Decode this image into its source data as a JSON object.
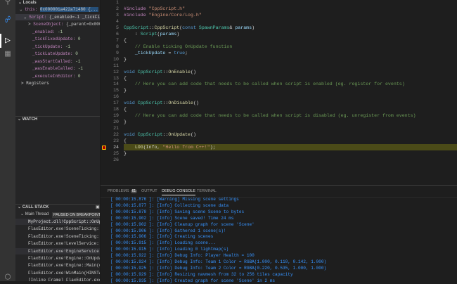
{
  "activity_bar": {
    "icons": [
      "search-icon",
      "source-control-icon",
      "run-debug-icon",
      "extensions-icon",
      "account-icon"
    ]
  },
  "variables": {
    "section": "Locals",
    "rows": [
      {
        "indent": 1,
        "chev": "v",
        "name": "this:",
        "value": "0x000001a422a71480 {...",
        "kind": "sel"
      },
      {
        "indent": 2,
        "chev": "v",
        "name": "Script:",
        "value": "{_enabled=-1 _tickFi...",
        "kind": "obj"
      },
      {
        "indent": 3,
        "chev": ">",
        "name": "SceneObject:",
        "value": "{_parent=0x000...",
        "kind": "obj"
      },
      {
        "indent": 4,
        "chev": "",
        "name": "_enabled:",
        "value": "-1",
        "kind": "num"
      },
      {
        "indent": 4,
        "chev": "",
        "name": "_tickFixedUpdate:",
        "value": "0",
        "kind": "num"
      },
      {
        "indent": 4,
        "chev": "",
        "name": "_tickUpdate:",
        "value": "-1",
        "kind": "num"
      },
      {
        "indent": 4,
        "chev": "",
        "name": "_tickLateUpdate:",
        "value": "0",
        "kind": "num"
      },
      {
        "indent": 4,
        "chev": "",
        "name": "_wasStartCalled:",
        "value": "-1",
        "kind": "num"
      },
      {
        "indent": 4,
        "chev": "",
        "name": "_wasEnableCalled:",
        "value": "-1",
        "kind": "num"
      },
      {
        "indent": 4,
        "chev": "",
        "name": "_executeInEditor:",
        "value": "0",
        "kind": "num"
      }
    ],
    "registers": "Registers"
  },
  "watch": {
    "title": "WATCH"
  },
  "call_stack": {
    "title": "CALL STACK",
    "thread": "Main Thread",
    "status": "PAUSED ON BREAKPOINT",
    "frames": [
      "MyProject.dll!CppScript::OnUpdate()",
      "FlaxEditor.exe!SceneTicking::Update",
      "FlaxEditor.exe!SceneTicking::Tick",
      "FlaxEditor.exe!LevelService::Update",
      "FlaxEditor.exe!EngineService::OnUpdate",
      "FlaxEditor.exe!Engine::OnUpdate()",
      "FlaxEditor.exe!Engine::Main(const",
      "FlaxEditor.exe!WinMain(HINSTANCE",
      "[Inline Frame] FlaxEditor.exe!..."
    ]
  },
  "editor": {
    "current_line": 24,
    "lines": [
      {
        "n": "1",
        "t": []
      },
      {
        "n": "2",
        "t": [
          [
            "#include ",
            "pp"
          ],
          [
            "\"CppScript.h\"",
            "str"
          ]
        ]
      },
      {
        "n": "3",
        "t": [
          [
            "#include ",
            "pp"
          ],
          [
            "\"Engine/Core/Log.h\"",
            "str"
          ]
        ]
      },
      {
        "n": "4",
        "t": []
      },
      {
        "n": "5",
        "t": [
          [
            "CppScript",
            "ty"
          ],
          [
            "::",
            "pl"
          ],
          [
            "CppScript",
            "fn"
          ],
          [
            "(",
            "pl"
          ],
          [
            "const ",
            "kw"
          ],
          [
            "SpawnParams",
            "ty"
          ],
          [
            "& ",
            "pl"
          ],
          [
            "params",
            "var"
          ],
          [
            ")",
            "pl"
          ]
        ]
      },
      {
        "n": "6",
        "t": [
          [
            "    : ",
            "pl"
          ],
          [
            "Script",
            "ty"
          ],
          [
            "(",
            "pl"
          ],
          [
            "params",
            "var"
          ],
          [
            ")",
            "pl"
          ]
        ]
      },
      {
        "n": "7",
        "t": [
          [
            "{",
            "pl"
          ]
        ]
      },
      {
        "n": "8",
        "t": [
          [
            "    // Enable ticking OnUpdate function",
            "cm"
          ]
        ]
      },
      {
        "n": "9",
        "t": [
          [
            "    ",
            "pl"
          ],
          [
            "_tickUpdate",
            "var"
          ],
          [
            " = ",
            "pl"
          ],
          [
            "true",
            "kw"
          ],
          [
            ";",
            "pl"
          ]
        ]
      },
      {
        "n": "10",
        "t": [
          [
            "}",
            "pl"
          ]
        ]
      },
      {
        "n": "11",
        "t": []
      },
      {
        "n": "12",
        "t": [
          [
            "void ",
            "kw"
          ],
          [
            "CppScript",
            "ty"
          ],
          [
            "::",
            "pl"
          ],
          [
            "OnEnable",
            "fn"
          ],
          [
            "()",
            "pl"
          ]
        ]
      },
      {
        "n": "13",
        "t": [
          [
            "{",
            "pl"
          ]
        ]
      },
      {
        "n": "14",
        "t": [
          [
            "    // Here you can add code that needs to be called when script is enabled (eg. register for events)",
            "cm"
          ]
        ]
      },
      {
        "n": "15",
        "t": [
          [
            "}",
            "pl"
          ]
        ]
      },
      {
        "n": "16",
        "t": []
      },
      {
        "n": "17",
        "t": [
          [
            "void ",
            "kw"
          ],
          [
            "CppScript",
            "ty"
          ],
          [
            "::",
            "pl"
          ],
          [
            "OnDisable",
            "fn"
          ],
          [
            "()",
            "pl"
          ]
        ]
      },
      {
        "n": "18",
        "t": [
          [
            "{",
            "pl"
          ]
        ]
      },
      {
        "n": "19",
        "t": [
          [
            "    // Here you can add code that needs to be called when script is disabled (eg. unregister from events)",
            "cm"
          ]
        ]
      },
      {
        "n": "20",
        "t": [
          [
            "}",
            "pl"
          ]
        ]
      },
      {
        "n": "21",
        "t": []
      },
      {
        "n": "22",
        "t": [
          [
            "void ",
            "kw"
          ],
          [
            "CppScript",
            "ty"
          ],
          [
            "::",
            "pl"
          ],
          [
            "OnUpdate",
            "fn"
          ],
          [
            "()",
            "pl"
          ]
        ]
      },
      {
        "n": "23",
        "t": [
          [
            "{",
            "pl"
          ]
        ]
      },
      {
        "n": "24",
        "t": [
          [
            "    ",
            "pl"
          ],
          [
            "LOG",
            "fn"
          ],
          [
            "(Info, ",
            "pl"
          ],
          [
            "\"Hello from C++!\"",
            "str"
          ],
          [
            ");",
            "pl"
          ]
        ]
      },
      {
        "n": "25",
        "t": [
          [
            "}",
            "pl"
          ]
        ]
      },
      {
        "n": "26",
        "t": []
      }
    ]
  },
  "panel": {
    "tabs": [
      {
        "label": "PROBLEMS",
        "badge": "61"
      },
      {
        "label": "OUTPUT"
      },
      {
        "label": "DEBUG CONSOLE",
        "active": true
      },
      {
        "label": "TERMINAL"
      }
    ],
    "console": [
      "[ 00:00:15.876 ]: [Warning] Missing scene settings",
      "[ 00:00:15.877 ]: [Info] Collecting scene data",
      "[ 00:00:15.878 ]: [Info] Saving scene Scene to bytes",
      "[ 00:00:15.902 ]: [Info] Scene saved! Time 24 ms",
      "[ 00:00:15.902 ]: [Info] Cleanup graph for scene 'Scene'",
      "[ 00:00:15.906 ]: [Info] Gathered 1 scene(s)!",
      "[ 00:00:15.906 ]: [Info] Creating scenes",
      "[ 00:00:15.915 ]: [Info] Loading scene...",
      "[ 00:00:15.915 ]: [Info] Loading 0 lightmap(s)",
      "[ 00:00:15.922 ]: [Info] Debug Info: Player Health = 100",
      "[ 00:00:15.924 ]: [Info] Debug Info: Team 1 Color = RGBA(1.000, 0.110, 0.142, 1.000)",
      "[ 00:00:15.925 ]: [Info] Debug Info: Team 2 Color = RGBA(0.220, 0.535, 1.000, 1.000)",
      "[ 00:00:15.929 ]: [Info] Resizing navmesh from 32 to 256 tiles capacity",
      "[ 00:00:15.935 ]: [Info] Created graph for scene 'Scene' in 2 ms"
    ]
  }
}
